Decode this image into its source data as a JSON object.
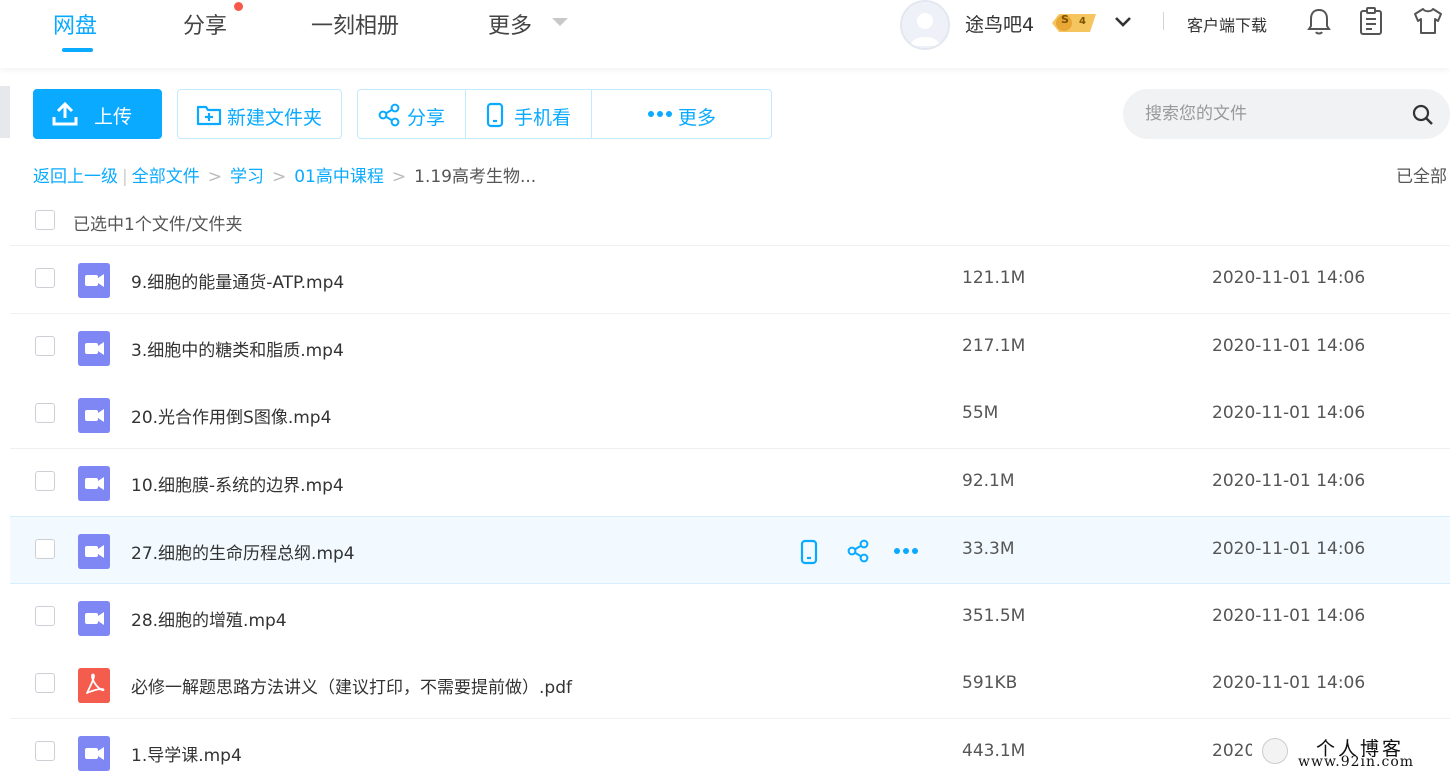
{
  "nav": {
    "tabs": [
      {
        "label": "网盘",
        "active": true
      },
      {
        "label": "分享",
        "has_notification": true
      },
      {
        "label": "一刻相册"
      },
      {
        "label": "更多"
      }
    ],
    "username": "途鸟吧4",
    "vip_badge": {
      "symbol": "S",
      "level": "4"
    },
    "client_download": "客户端下载",
    "icons": [
      "bell-icon",
      "clipboard-icon",
      "shirt-icon",
      "chevron-down-icon"
    ]
  },
  "toolbar": {
    "upload": "上传",
    "new_folder": "新建文件夹",
    "share": "分享",
    "mobile_view": "手机看",
    "more": "更多"
  },
  "search": {
    "placeholder": "搜索您的文件"
  },
  "breadcrumb": {
    "back": "返回上一级",
    "items": [
      "全部文件",
      "学习",
      "01高中课程"
    ],
    "current": "1.19高考生物..."
  },
  "loaded_status": "已全部",
  "selection_text": "已选中1个文件/文件夹",
  "files": [
    {
      "name": "9.细胞的能量通货-ATP.mp4",
      "size": "121.1M",
      "time": "2020-11-01 14:06",
      "type": "video"
    },
    {
      "name": "3.细胞中的糖类和脂质.mp4",
      "size": "217.1M",
      "time": "2020-11-01 14:06",
      "type": "video"
    },
    {
      "name": "20.光合作用倒S图像.mp4",
      "size": "55M",
      "time": "2020-11-01 14:06",
      "type": "video"
    },
    {
      "name": "10.细胞膜-系统的边界.mp4",
      "size": "92.1M",
      "time": "2020-11-01 14:06",
      "type": "video"
    },
    {
      "name": "27.细胞的生命历程总纲.mp4",
      "size": "33.3M",
      "time": "2020-11-01 14:06",
      "type": "video",
      "hover": true
    },
    {
      "name": "28.细胞的增殖.mp4",
      "size": "351.5M",
      "time": "2020-11-01 14:06",
      "type": "video"
    },
    {
      "name": "必修一解题思路方法讲义（建议打印，不需要提前做）.pdf",
      "size": "591KB",
      "time": "2020-11-01 14:06",
      "type": "pdf"
    },
    {
      "name": "1.导学课.mp4",
      "size": "443.1M",
      "time": "2020",
      "type": "video"
    }
  ],
  "watermark": {
    "title": "个人博客",
    "url": "www.92in.com"
  },
  "colors": {
    "accent": "#09aaff",
    "video_icon": "#7e87f3",
    "pdf_icon": "#f45c4e",
    "notification": "#f8584a",
    "hover_row": "#f2faff"
  }
}
